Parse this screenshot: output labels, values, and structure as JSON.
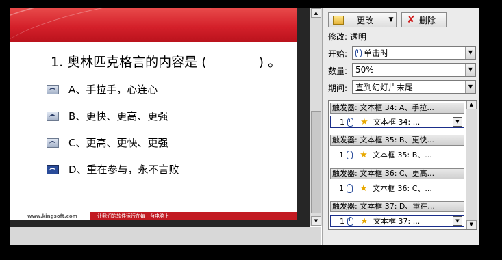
{
  "slide": {
    "question": "1. 奥林匹克格言的内容是 (　　　　) 。",
    "options": [
      "A、手拉手，心连心",
      "B、更快、更高、更强",
      "C、更高、更快、更强",
      "D、重在参与，永不言败"
    ],
    "footer_url": "www.kingsoft.com",
    "footer_slogan": "让我们的软件运行在每一台电脑上"
  },
  "pane": {
    "change_button": "更改",
    "delete_button": "删除",
    "modify_label": "修改: 透明",
    "start_label": "开始:",
    "start_value": "单击时",
    "amount_label": "数量:",
    "amount_value": "50%",
    "period_label": "期间:",
    "period_value": "直到幻灯片末尾",
    "animations": [
      {
        "trigger": "触发器: 文本框 34: A、手拉...",
        "num": "1",
        "text": "文本框 34: ...",
        "selected": true
      },
      {
        "trigger": "触发器: 文本框 35: B、更快...",
        "num": "1",
        "text": "文本框 35: B、...",
        "selected": false
      },
      {
        "trigger": "触发器: 文本框 36: C、更高...",
        "num": "1",
        "text": "文本框 36: C、...",
        "selected": false
      },
      {
        "trigger": "触发器: 文本框 37: D、重在...",
        "num": "1",
        "text": "文本框 37: ...",
        "selected": true
      }
    ]
  },
  "icons": {
    "change": "effect-icon",
    "delete": "delete-x-icon",
    "mouse": "mouse-click-icon",
    "star": "star-effect-icon",
    "option": "button-icon"
  }
}
